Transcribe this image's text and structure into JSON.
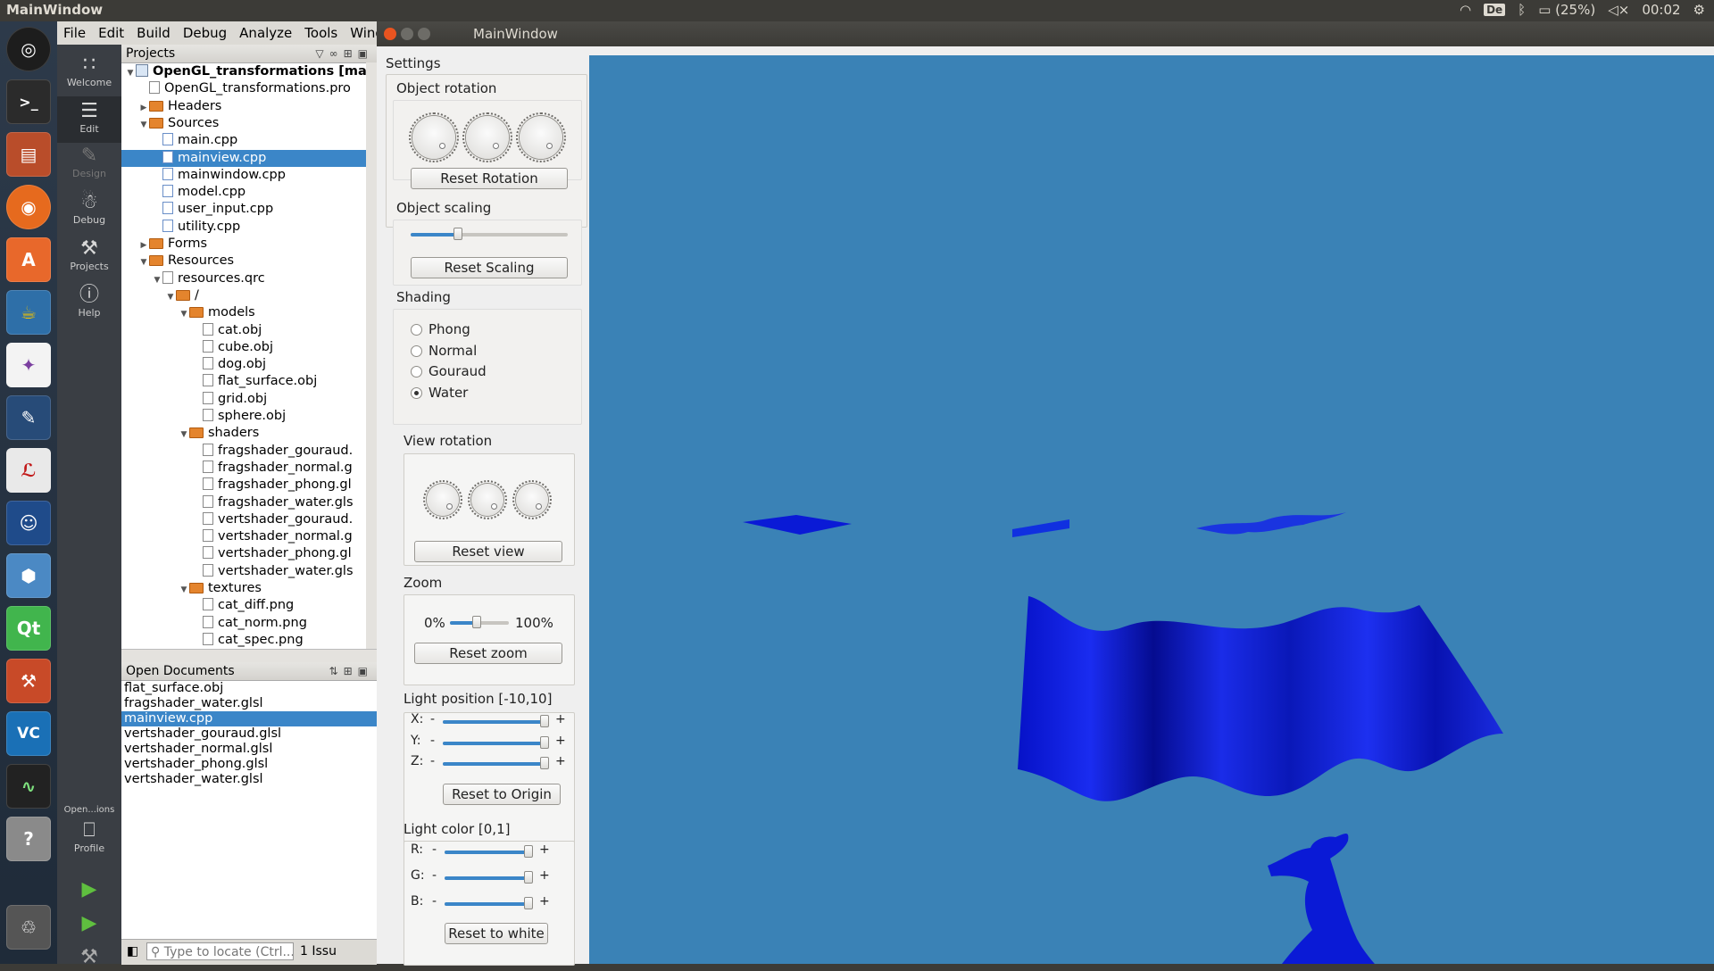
{
  "topbar": {
    "app_title": "MainWindow",
    "keyboard_layout": "De",
    "battery": "(25%)",
    "clock": "00:02"
  },
  "launcher": {
    "icons": [
      "ubuntu-dash-icon",
      "terminal-icon",
      "files-icon",
      "firefox-icon",
      "software-center-icon",
      "teapot-app-icon",
      "inkscape-icon",
      "libreoffice-draw-icon",
      "pdf-viewer-icon",
      "gnome-game-icon",
      "virtualbox-icon",
      "qt-creator-icon",
      "settings-icon",
      "vscode-icon",
      "system-monitor-icon",
      "help-icon",
      "trash-icon"
    ]
  },
  "creator": {
    "menu": [
      "File",
      "Edit",
      "Build",
      "Debug",
      "Analyze",
      "Tools",
      "Wind"
    ],
    "modes": [
      {
        "label": "Welcome",
        "icon": "grid-icon"
      },
      {
        "label": "Edit",
        "icon": "edit-doc-icon"
      },
      {
        "label": "Design",
        "icon": "pencil-icon"
      },
      {
        "label": "Debug",
        "icon": "bug-icon"
      },
      {
        "label": "Projects",
        "icon": "wrench-icon"
      },
      {
        "label": "Help",
        "icon": "help-icon"
      }
    ],
    "open_sessions_label": "Open...ions",
    "profile_label": "Profile",
    "projects_header": "Projects",
    "tree": [
      {
        "depth": 0,
        "arrow": "down",
        "icon": "proj",
        "label": "OpenGL_transformations [maste",
        "bold": true
      },
      {
        "depth": 1,
        "arrow": "",
        "icon": "file",
        "label": "OpenGL_transformations.pro"
      },
      {
        "depth": 1,
        "arrow": "right",
        "icon": "folder",
        "label": "Headers"
      },
      {
        "depth": 1,
        "arrow": "down",
        "icon": "folder",
        "label": "Sources"
      },
      {
        "depth": 2,
        "arrow": "",
        "icon": "cpp",
        "label": "main.cpp"
      },
      {
        "depth": 2,
        "arrow": "",
        "icon": "cpp",
        "label": "mainview.cpp",
        "selected": true
      },
      {
        "depth": 2,
        "arrow": "",
        "icon": "cpp",
        "label": "mainwindow.cpp"
      },
      {
        "depth": 2,
        "arrow": "",
        "icon": "cpp",
        "label": "model.cpp"
      },
      {
        "depth": 2,
        "arrow": "",
        "icon": "cpp",
        "label": "user_input.cpp"
      },
      {
        "depth": 2,
        "arrow": "",
        "icon": "cpp",
        "label": "utility.cpp"
      },
      {
        "depth": 1,
        "arrow": "right",
        "icon": "folder",
        "label": "Forms"
      },
      {
        "depth": 1,
        "arrow": "down",
        "icon": "folder",
        "label": "Resources"
      },
      {
        "depth": 2,
        "arrow": "down",
        "icon": "file",
        "label": "resources.qrc"
      },
      {
        "depth": 3,
        "arrow": "down",
        "icon": "folder",
        "label": "/"
      },
      {
        "depth": 4,
        "arrow": "down",
        "icon": "folder",
        "label": "models"
      },
      {
        "depth": 5,
        "arrow": "",
        "icon": "file",
        "label": "cat.obj"
      },
      {
        "depth": 5,
        "arrow": "",
        "icon": "file",
        "label": "cube.obj"
      },
      {
        "depth": 5,
        "arrow": "",
        "icon": "file",
        "label": "dog.obj"
      },
      {
        "depth": 5,
        "arrow": "",
        "icon": "file",
        "label": "flat_surface.obj"
      },
      {
        "depth": 5,
        "arrow": "",
        "icon": "file",
        "label": "grid.obj"
      },
      {
        "depth": 5,
        "arrow": "",
        "icon": "file",
        "label": "sphere.obj"
      },
      {
        "depth": 4,
        "arrow": "down",
        "icon": "folder",
        "label": "shaders"
      },
      {
        "depth": 5,
        "arrow": "",
        "icon": "glsl",
        "label": "fragshader_gouraud."
      },
      {
        "depth": 5,
        "arrow": "",
        "icon": "glsl",
        "label": "fragshader_normal.g"
      },
      {
        "depth": 5,
        "arrow": "",
        "icon": "glsl",
        "label": "fragshader_phong.gl"
      },
      {
        "depth": 5,
        "arrow": "",
        "icon": "glsl",
        "label": "fragshader_water.gls"
      },
      {
        "depth": 5,
        "arrow": "",
        "icon": "glsl",
        "label": "vertshader_gouraud."
      },
      {
        "depth": 5,
        "arrow": "",
        "icon": "glsl",
        "label": "vertshader_normal.g"
      },
      {
        "depth": 5,
        "arrow": "",
        "icon": "glsl",
        "label": "vertshader_phong.gl"
      },
      {
        "depth": 5,
        "arrow": "",
        "icon": "glsl",
        "label": "vertshader_water.gls"
      },
      {
        "depth": 4,
        "arrow": "down",
        "icon": "folder",
        "label": "textures"
      },
      {
        "depth": 5,
        "arrow": "",
        "icon": "file",
        "label": "cat_diff.png"
      },
      {
        "depth": 5,
        "arrow": "",
        "icon": "file",
        "label": "cat_norm.png"
      },
      {
        "depth": 5,
        "arrow": "",
        "icon": "file",
        "label": "cat_spec.png"
      }
    ],
    "open_documents_header": "Open Documents",
    "open_documents": [
      {
        "label": "flat_surface.obj"
      },
      {
        "label": "fragshader_water.glsl"
      },
      {
        "label": "mainview.cpp",
        "selected": true
      },
      {
        "label": "vertshader_gouraud.glsl"
      },
      {
        "label": "vertshader_normal.glsl"
      },
      {
        "label": "vertshader_phong.glsl"
      },
      {
        "label": "vertshader_water.glsl"
      }
    ],
    "locator_placeholder": "Type to locate (Ctrl...",
    "issues_label": "1  Issu"
  },
  "mainwindow": {
    "title": "MainWindow",
    "settings": {
      "heading": "Settings",
      "object_rotation": {
        "label": "Object rotation",
        "reset": "Reset Rotation"
      },
      "object_scaling": {
        "label": "Object scaling",
        "reset": "Reset Scaling",
        "value": 0.3
      },
      "shading": {
        "label": "Shading",
        "options": [
          {
            "label": "Phong",
            "checked": false
          },
          {
            "label": "Normal",
            "checked": false
          },
          {
            "label": "Gouraud",
            "checked": false
          },
          {
            "label": "Water",
            "checked": true
          }
        ]
      },
      "view_rotation": {
        "label": "View rotation",
        "reset": "Reset view"
      },
      "zoom": {
        "label": "Zoom",
        "min_label": "0%",
        "max_label": "100%",
        "value": 0.45,
        "reset": "Reset zoom"
      },
      "light_position": {
        "label": "Light position [-10,10]",
        "axes": [
          {
            "name": "X:",
            "value": 1.0
          },
          {
            "name": "Y:",
            "value": 1.0
          },
          {
            "name": "Z:",
            "value": 1.0
          }
        ],
        "minus": "-",
        "plus": "+",
        "reset": "Reset to Origin"
      },
      "light_color": {
        "label": "Light color [0,1]",
        "channels": [
          {
            "name": "R:",
            "value": 1.0
          },
          {
            "name": "G:",
            "value": 1.0
          },
          {
            "name": "B:",
            "value": 1.0
          }
        ],
        "minus": "-",
        "plus": "+",
        "reset": "Reset to white"
      }
    },
    "viewport": {
      "background": "#3a82b6",
      "mesh_color": "#0a1ad6",
      "objects": [
        "flat-surface-left",
        "flat-surface-middle",
        "swimming-cat",
        "water-wave-surface",
        "cat-bottom"
      ]
    }
  }
}
